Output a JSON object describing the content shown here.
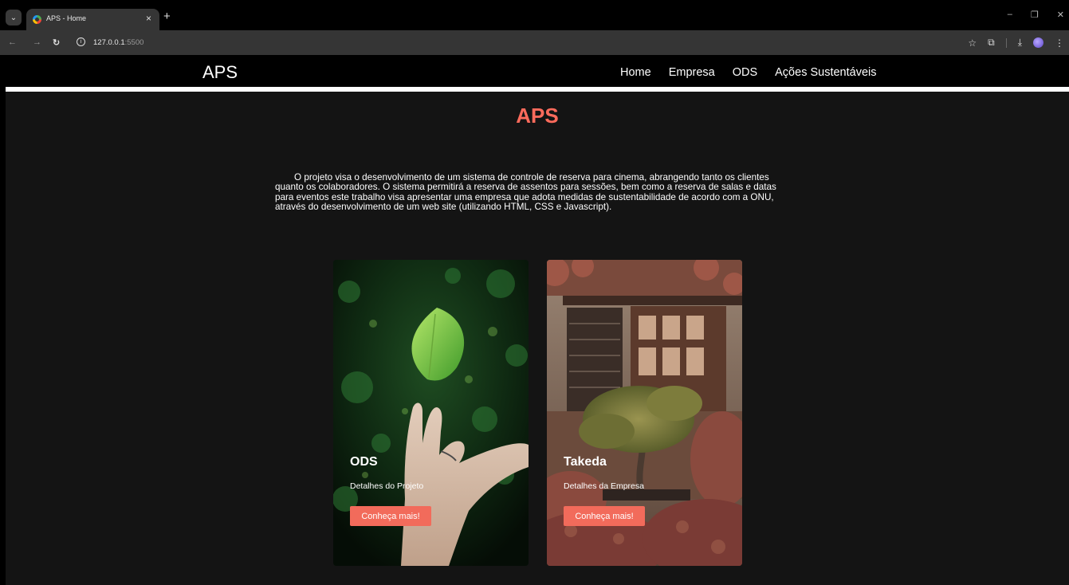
{
  "browser": {
    "tab_title": "APS - Home",
    "tab_close": "×",
    "new_tab": "+",
    "url_host": "127.0.0.1",
    "url_port": ":5500"
  },
  "site": {
    "logo": "APS",
    "nav": [
      "Home",
      "Empresa",
      "ODS",
      "Ações Sustentáveis"
    ]
  },
  "main": {
    "title": "APS",
    "title_color": "#ff6b5c",
    "intro": "O projeto visa o desenvolvimento de um sistema de controle de reserva para cinema, abrangendo tanto os clientes quanto os colaboradores. O sistema permitirá a reserva de assentos para sessões, bem como a reserva de salas e datas para eventos este trabalho visa apresentar uma empresa que adota medidas de sustentabilidade de acordo com a ONU, através do desenvolvimento de um web site (utilizando HTML, CSS e Javascript).",
    "cards": [
      {
        "title": "ODS",
        "subtitle": "Detalhes do Projeto",
        "button": "Conheça mais!",
        "image": "leaf-hand-photo"
      },
      {
        "title": "Takeda",
        "subtitle": "Detalhes da Empresa",
        "button": "Conheça mais!",
        "image": "bonsai-house-photo"
      }
    ],
    "button_color": "#f26b5b"
  }
}
